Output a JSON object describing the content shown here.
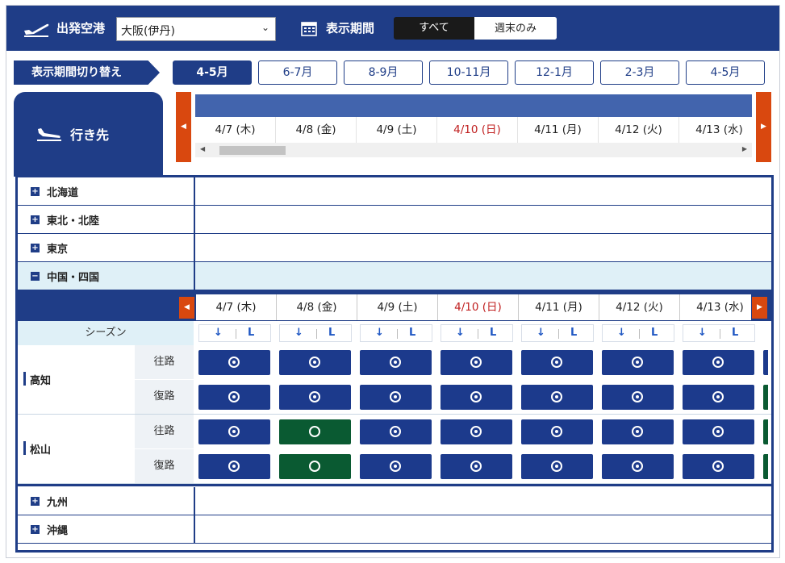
{
  "topbar": {
    "origin_label": "出発空港",
    "origin_value": "大阪(伊丹)",
    "period_label": "表示期間",
    "seg_all": "すべて",
    "seg_weekend": "週末のみ"
  },
  "period_switch": {
    "label": "表示期間切り替え",
    "buttons": [
      "4-5月",
      "6-7月",
      "8-9月",
      "10-11月",
      "12-1月",
      "2-3月",
      "4-5月"
    ],
    "active_index": 0
  },
  "dest_tab": {
    "label": "行き先"
  },
  "dates": [
    "4/7 (木)",
    "4/8 (金)",
    "4/9 (土)",
    "4/10 (日)",
    "4/11 (月)",
    "4/12 (火)",
    "4/13 (水)"
  ],
  "sunday_index": 3,
  "regions": [
    {
      "name": "北海道",
      "icon": "plus"
    },
    {
      "name": "東北・北陸",
      "icon": "plus"
    },
    {
      "name": "東京",
      "icon": "plus"
    },
    {
      "name": "中国・四国",
      "icon": "minus"
    },
    {
      "name": "九州",
      "icon": "plus"
    },
    {
      "name": "沖縄",
      "icon": "plus"
    }
  ],
  "season": {
    "label": "シーズン",
    "arrow": "↓",
    "letter": "L"
  },
  "cities": [
    {
      "name": "高知",
      "outbound": "往路",
      "return": "復路",
      "outbound_cells": [
        "blue",
        "blue",
        "blue",
        "blue",
        "blue",
        "blue",
        "blue"
      ],
      "return_cells": [
        "blue",
        "blue",
        "blue",
        "blue",
        "blue",
        "blue",
        "blue"
      ]
    },
    {
      "name": "松山",
      "outbound": "往路",
      "return": "復路",
      "outbound_cells": [
        "blue",
        "green",
        "blue",
        "blue",
        "blue",
        "blue",
        "blue"
      ],
      "return_cells": [
        "blue",
        "green",
        "blue",
        "blue",
        "blue",
        "blue",
        "blue"
      ]
    }
  ],
  "colors": {
    "navy": "#1f3d87",
    "accent": "#d9480f",
    "cell_blue": "#1c3a8c",
    "cell_green": "#0a5a32",
    "sunday": "#c02020"
  }
}
